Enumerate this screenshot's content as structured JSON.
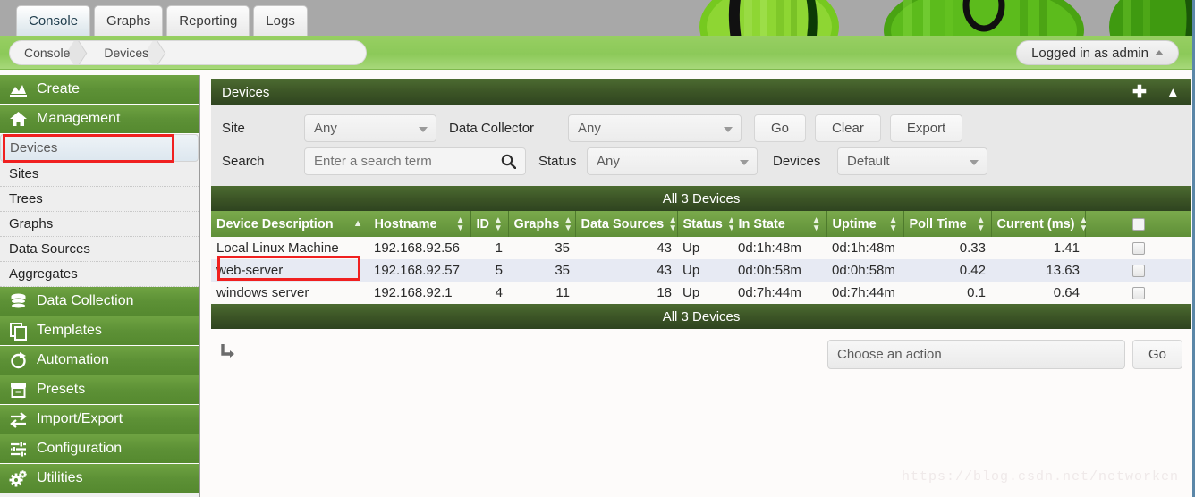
{
  "tabs": [
    {
      "label": "Console",
      "active": true
    },
    {
      "label": "Graphs",
      "active": false
    },
    {
      "label": "Reporting",
      "active": false
    },
    {
      "label": "Logs",
      "active": false
    }
  ],
  "breadcrumb": [
    "Console",
    "Devices"
  ],
  "user": {
    "label": "Logged in as admin"
  },
  "sidebar": [
    {
      "label": "Create",
      "type": "head",
      "icon": "chart-area-icon"
    },
    {
      "label": "Management",
      "type": "head",
      "icon": "home-icon"
    },
    {
      "label": "Devices",
      "type": "sub",
      "selected": true
    },
    {
      "label": "Sites",
      "type": "sub",
      "selected": false
    },
    {
      "label": "Trees",
      "type": "sub",
      "selected": false
    },
    {
      "label": "Graphs",
      "type": "sub",
      "selected": false
    },
    {
      "label": "Data Sources",
      "type": "sub",
      "selected": false
    },
    {
      "label": "Aggregates",
      "type": "sub",
      "selected": false
    },
    {
      "label": "Data Collection",
      "type": "head",
      "icon": "database-icon"
    },
    {
      "label": "Templates",
      "type": "head",
      "icon": "copy-icon"
    },
    {
      "label": "Automation",
      "type": "head",
      "icon": "automation-icon"
    },
    {
      "label": "Presets",
      "type": "head",
      "icon": "presets-icon"
    },
    {
      "label": "Import/Export",
      "type": "head",
      "icon": "import-export-icon"
    },
    {
      "label": "Configuration",
      "type": "head",
      "icon": "sliders-icon"
    },
    {
      "label": "Utilities",
      "type": "head",
      "icon": "gears-icon"
    }
  ],
  "panel": {
    "title": "Devices",
    "add_icon": "plus-icon",
    "collapse_icon": "chevron-up-icon"
  },
  "filters": {
    "site_label": "Site",
    "site_value": "Any",
    "collector_label": "Data Collector",
    "collector_value": "Any",
    "go_label": "Go",
    "clear_label": "Clear",
    "export_label": "Export",
    "search_label": "Search",
    "search_value": "",
    "search_placeholder": "Enter a search term",
    "search_icon": "search-icon",
    "status_label": "Status",
    "status_value": "Any",
    "devices_label": "Devices",
    "devices_value": "Default"
  },
  "table": {
    "caption_top": "All 3 Devices",
    "caption_bottom": "All 3 Devices",
    "columns": [
      {
        "label": "Device Description",
        "sort": "asc",
        "align": "left"
      },
      {
        "label": "Hostname",
        "sort": "both",
        "align": "left"
      },
      {
        "label": "ID",
        "sort": "both",
        "align": "left"
      },
      {
        "label": "Graphs",
        "sort": "both",
        "align": "left"
      },
      {
        "label": "Data Sources",
        "sort": "both",
        "align": "left"
      },
      {
        "label": "Status",
        "sort": "both",
        "align": "left"
      },
      {
        "label": "In State",
        "sort": "both",
        "align": "left"
      },
      {
        "label": "Uptime",
        "sort": "both",
        "align": "left"
      },
      {
        "label": "Poll Time",
        "sort": "both",
        "align": "left"
      },
      {
        "label": "Current (ms)",
        "sort": "both",
        "align": "left"
      }
    ],
    "select_all_icon": "checkbox-icon",
    "rows": [
      {
        "description": "Local Linux Machine",
        "hostname": "192.168.92.56",
        "id": "1",
        "graphs": "35",
        "data_sources": "43",
        "status": "Up",
        "in_state": "0d:1h:48m",
        "uptime": "0d:1h:48m",
        "poll_time": "0.33",
        "current_ms": "1.41",
        "highlighted": true
      },
      {
        "description": "web-server",
        "hostname": "192.168.92.57",
        "id": "5",
        "graphs": "35",
        "data_sources": "43",
        "status": "Up",
        "in_state": "0d:0h:58m",
        "uptime": "0d:0h:58m",
        "poll_time": "0.42",
        "current_ms": "13.63",
        "highlighted": false
      },
      {
        "description": "windows server",
        "hostname": "192.168.92.1",
        "id": "4",
        "graphs": "11",
        "data_sources": "18",
        "status": "Up",
        "in_state": "0d:7h:44m",
        "uptime": "0d:7h:44m",
        "poll_time": "0.1",
        "current_ms": "0.64",
        "highlighted": false
      }
    ]
  },
  "actions": {
    "subarrow_icon": "subdirectory-arrow-icon",
    "action_value": "Choose an action",
    "go_label": "Go"
  },
  "watermark": "https://blog.csdn.net/networken",
  "colors": {
    "brand_green": "#5d9136",
    "header_dark": "#3c5526",
    "table_header": "#6c9c41",
    "crumb_green": "#8cc959",
    "highlight_red": "#f02020",
    "link_green": "#49751f",
    "status_up": "#92b973"
  }
}
